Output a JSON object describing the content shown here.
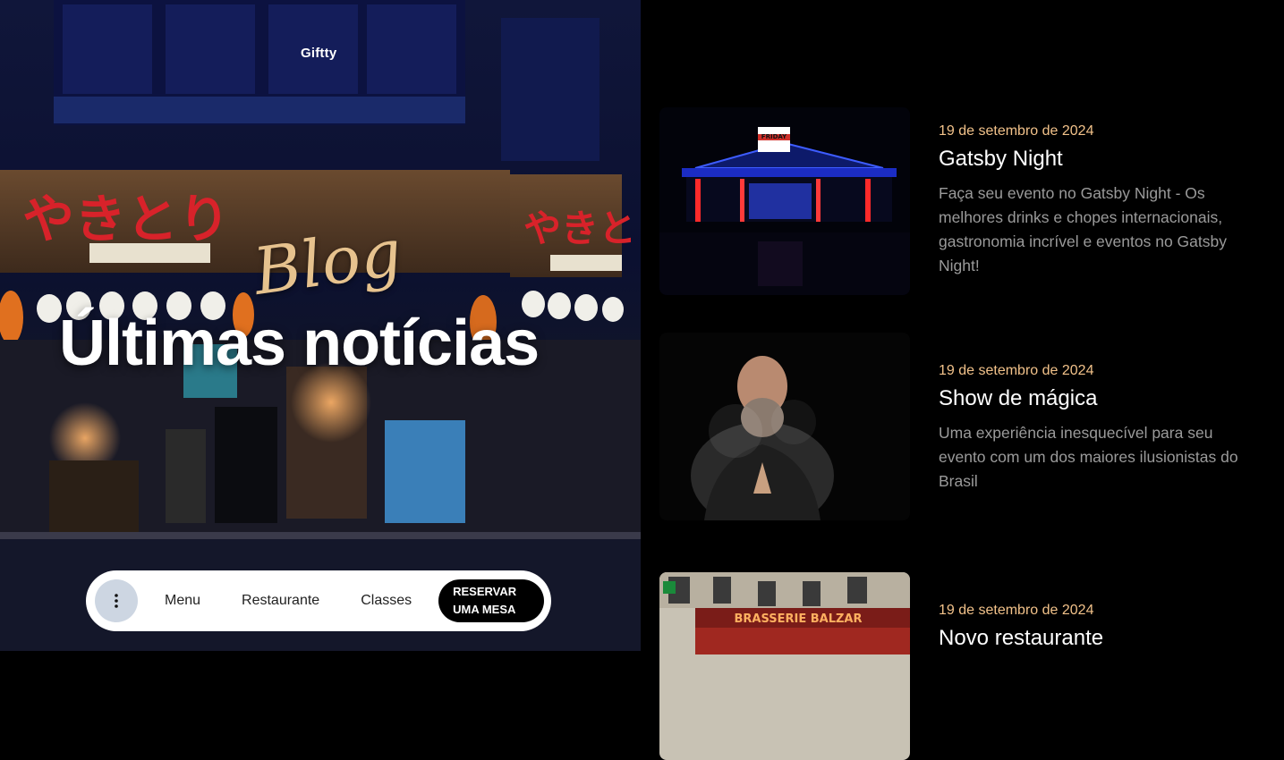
{
  "brand": {
    "name": "Giftty"
  },
  "hero": {
    "script_label": "Blog",
    "title": "Últimas notícias"
  },
  "nav": {
    "more_icon": "more-vertical-icon",
    "links": [
      "Menu",
      "Restaurante",
      "Classes"
    ],
    "reserve_line1": "RESERVAR",
    "reserve_line2": "UMA MESA"
  },
  "posts": [
    {
      "date": "19 de setembro de 2024",
      "title": "Gatsby Night",
      "excerpt": "Faça seu evento no Gatsby Night - Os melhores drinks e chopes internacionais, gastronomia incrível e eventos no Gatsby Night!",
      "image_sign": "FRIDAY"
    },
    {
      "date": "19 de setembro de 2024",
      "title": "Show de mágica",
      "excerpt": "Uma experiência inesquecível para seu evento com um dos maiores ilusionistas do Brasil"
    },
    {
      "date": "19 de setembro de 2024",
      "title": "Novo restaurante",
      "excerpt": "",
      "image_sign": "BRASSERIE BALZAR"
    }
  ],
  "colors": {
    "accent": "#f2c28a",
    "script_gold": "#e6c28e",
    "nav_bg": "#ffffff",
    "reserve_bg": "#000000",
    "more_btn_bg": "#cdd6e2"
  }
}
